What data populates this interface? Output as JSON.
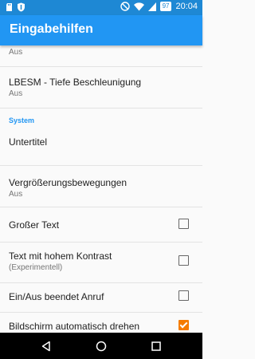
{
  "status_bar": {
    "battery": "97",
    "time": "20:04"
  },
  "app_bar": {
    "title": "Eingabehilfen"
  },
  "settings": {
    "top_summary": "Aus",
    "lbesm": {
      "title": "LBESM - Tiefe Beschleunigung",
      "summary": "Aus"
    },
    "section_system": "System",
    "untertitel": {
      "title": "Untertitel"
    },
    "vergroesserung": {
      "title": "Vergrößerungsbewegungen",
      "summary": "Aus"
    },
    "grosser_text": {
      "title": "Großer Text",
      "checked": false
    },
    "kontrast": {
      "title": "Text mit hohem Kontrast",
      "summary": "(Experimentell)",
      "checked": false
    },
    "ein_aus": {
      "title": "Ein/Aus beendet Anruf",
      "checked": false
    },
    "autorotate": {
      "title": "Bildschirm automatisch drehen",
      "checked": true
    }
  },
  "colors": {
    "status_bar": "#1e88d4",
    "app_bar": "#2196f3",
    "accent": "#f57c00"
  },
  "icons": [
    "sd-card-icon",
    "shield-icon",
    "do-not-disturb-icon",
    "wifi-icon",
    "cell-signal-icon",
    "battery-icon",
    "back-icon",
    "home-icon",
    "recents-icon"
  ]
}
